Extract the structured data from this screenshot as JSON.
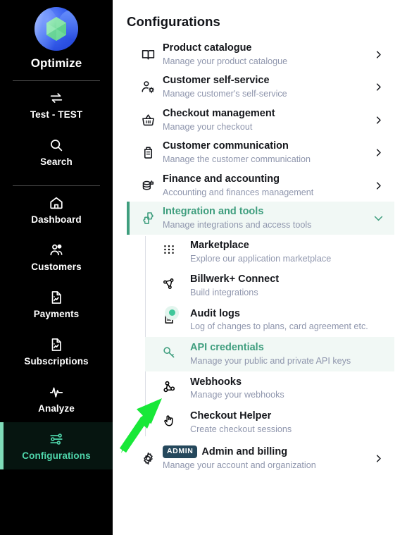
{
  "colors": {
    "sidebar_bg": "#000000",
    "sidebar_active_bg": "#061510",
    "sidebar_active_bar": "#7fdcb9",
    "sidebar_active_text": "#4fd6ab",
    "accent_green": "#3f9e7e",
    "accent_green_bg": "#f1f8f5",
    "status_dot": "#3fc79a",
    "admin_badge_bg": "#25485c",
    "subtitle_text": "#8f96ad",
    "title_text": "#15171c",
    "annotation_arrow": "#18e838"
  },
  "sidebar": {
    "brand": {
      "name": "Optimize",
      "icon": "optimize-logo"
    },
    "groups": [
      {
        "items": [
          {
            "label": "Test - TEST",
            "icon": "switch-arrows-icon",
            "active": false
          },
          {
            "label": "Search",
            "icon": "search-icon",
            "active": false
          }
        ]
      },
      {
        "items": [
          {
            "label": "Dashboard",
            "icon": "home-icon",
            "active": false
          },
          {
            "label": "Customers",
            "icon": "users-icon",
            "active": false
          },
          {
            "label": "Payments",
            "icon": "document-chart-icon",
            "active": false
          },
          {
            "label": "Subscriptions",
            "icon": "document-chart-icon",
            "active": false
          },
          {
            "label": "Analyze",
            "icon": "pulse-icon",
            "active": false
          },
          {
            "label": "Configurations",
            "icon": "sliders-icon",
            "active": true
          }
        ]
      }
    ]
  },
  "main": {
    "page_title": "Configurations",
    "rows": [
      {
        "title": "Product catalogue",
        "subtitle": "Manage your product catalogue",
        "icon": "book-icon",
        "chevron": "chevron-right-icon",
        "state": "collapsed"
      },
      {
        "title": "Customer self-service",
        "subtitle": "Manage customer's self-service",
        "icon": "user-gear-icon",
        "chevron": "chevron-right-icon",
        "state": "collapsed"
      },
      {
        "title": "Checkout management",
        "subtitle": "Manage your checkout",
        "icon": "basket-icon",
        "chevron": "chevron-right-icon",
        "state": "collapsed"
      },
      {
        "title": "Customer communication",
        "subtitle": "Manage the customer communication",
        "icon": "clipboard-icon",
        "chevron": "chevron-right-icon",
        "state": "collapsed"
      },
      {
        "title": "Finance and accounting",
        "subtitle": "Accounting and finances management",
        "icon": "coins-stack-icon",
        "chevron": "chevron-right-icon",
        "state": "collapsed"
      },
      {
        "title": "Integration and tools",
        "subtitle": "Manage integrations and access tools",
        "icon": "puzzle-icon",
        "chevron": "chevron-down-icon",
        "state": "expanded"
      }
    ],
    "sub_rows": [
      {
        "title": "Marketplace",
        "subtitle": "Explore our application marketplace",
        "icon": "grid-dots-icon",
        "selected": false,
        "has_status_dot": false
      },
      {
        "title": "Billwerk+ Connect",
        "subtitle": "Build integrations",
        "icon": "nodes-icon",
        "selected": false,
        "has_status_dot": false
      },
      {
        "title": "Audit logs",
        "subtitle": "Log of changes to plans, card agreement etc.",
        "icon": "file-lines-icon",
        "selected": false,
        "has_status_dot": true
      },
      {
        "title": "API credentials",
        "subtitle": "Manage your public and private API keys",
        "icon": "key-icon",
        "selected": true,
        "has_status_dot": false
      },
      {
        "title": "Webhooks",
        "subtitle": "Manage your webhooks",
        "icon": "webhook-icon",
        "selected": false,
        "has_status_dot": false
      },
      {
        "title": "Checkout Helper",
        "subtitle": "Create checkout sessions",
        "icon": "hand-pointer-icon",
        "selected": false,
        "has_status_dot": false
      }
    ],
    "admin_row": {
      "badge": "ADMIN",
      "title": "Admin and billing",
      "subtitle": "Manage your account and organization",
      "icon": "gear-icon",
      "chevron": "chevron-right-icon"
    }
  },
  "annotation": {
    "type": "arrow",
    "points_to": "API credentials",
    "color": "#18e838"
  }
}
